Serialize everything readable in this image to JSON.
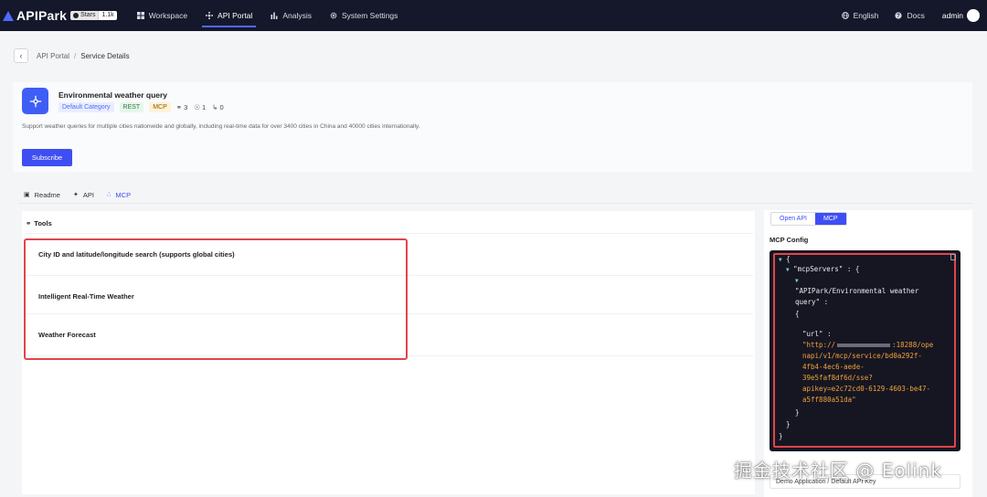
{
  "topbar": {
    "logo_text": "APIPark",
    "github_badge": {
      "label": "Stars",
      "count": "1.1k"
    },
    "nav": [
      {
        "label": "Workspace",
        "icon": "grid-icon"
      },
      {
        "label": "API Portal",
        "icon": "portal-icon",
        "active": true
      },
      {
        "label": "Analysis",
        "icon": "bar-chart-icon"
      },
      {
        "label": "System Settings",
        "icon": "gear-icon"
      }
    ],
    "language": "English",
    "docs": "Docs",
    "user": "admin"
  },
  "breadcrumb": {
    "parent": "API Portal",
    "separator": "/",
    "current": "Service Details"
  },
  "service": {
    "title": "Environmental weather query",
    "category": "Default Category",
    "protocol_tag": "REST",
    "mcp_tag": "MCP",
    "api_count": "3",
    "subscriber_count": "1",
    "version_count": "0",
    "description": "Support weather queries for multiple cities nationwide and globally, including real-time data for over 3400 cities in China and 40000 cities internationally.",
    "subscribe_label": "Subscribe"
  },
  "tabs": [
    {
      "label": "Readme",
      "icon": "readme-icon"
    },
    {
      "label": "API",
      "icon": "api-icon"
    },
    {
      "label": "MCP",
      "icon": "mcp-icon",
      "active": true
    }
  ],
  "tools": {
    "heading": "Tools",
    "items": [
      "City ID and latitude/longitude search (supports global cities)",
      "Intelligent Real-Time Weather",
      "Weather Forecast"
    ]
  },
  "right_panel": {
    "toggle": [
      "Open API",
      "MCP"
    ],
    "toggle_selected": "MCP",
    "config_label": "MCP Config",
    "code": {
      "l1": "{",
      "l2_key": "\"mcpServers\"",
      "l2_rest": " : {",
      "l3_key_a": "\"APIPark/Environmental weather",
      "l3_key_b": "query\"",
      "l3_rest": " :",
      "l4": "{",
      "l5_key": "\"url\"",
      "l5_rest": " :",
      "url_a": "\"http://",
      "url_a2": ":18288/ope",
      "url_b": "napi/v1/mcp/service/bd0a292f-",
      "url_c": "4fb4-4ec6-aede-",
      "url_d": "39e5faf8df6d/sse?",
      "url_e": "apikey=e2c72cd0-6129-4603-be47-",
      "url_f": "a5ff880a51da\"",
      "c1": "}",
      "c2": "}",
      "c3": "}"
    },
    "app_key": "Demo Application / Default API Key"
  },
  "watermark": "掘金技术社区 @ Eolink",
  "colors": {
    "nav_bg": "#15182b",
    "accent": "#3f4ef2",
    "highlight": "#e0454a",
    "code_bg": "#161622",
    "string": "#f0a23a"
  }
}
